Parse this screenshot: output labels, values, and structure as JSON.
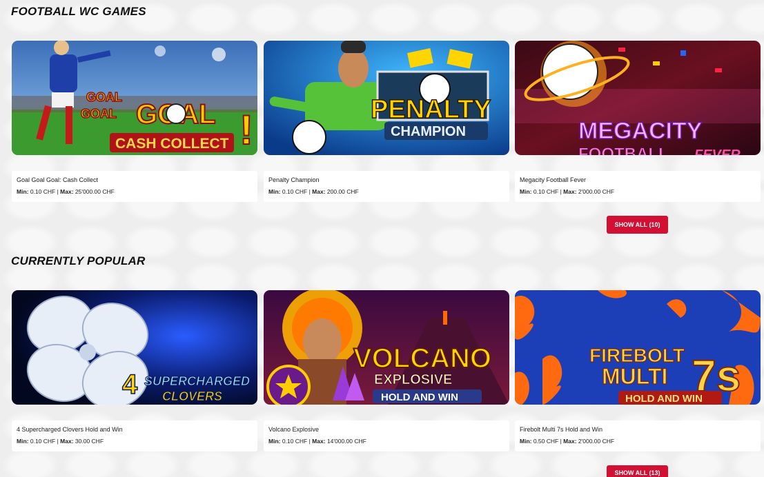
{
  "sections": [
    {
      "title": "FOOTBALL WC GAMES",
      "show_all_label": "SHOW ALL (10)",
      "games": [
        {
          "name": "Goal Goal Goal: Cash Collect",
          "min_label": "Min:",
          "min": "0.10 CHF",
          "max_label": "Max:",
          "max": "25'000.00 CHF",
          "logo": [
            "GOAL",
            "GOAL",
            "GOAL",
            "CASH COLLECT"
          ]
        },
        {
          "name": "Penalty Champion",
          "min_label": "Min:",
          "min": "0.10 CHF",
          "max_label": "Max:",
          "max": "200.00 CHF",
          "logo": [
            "PENALTY",
            "CHAMPION"
          ]
        },
        {
          "name": "Megacity Football Fever",
          "min_label": "Min:",
          "min": "0.10 CHF",
          "max_label": "Max:",
          "max": "2'000.00 CHF",
          "logo": [
            "MEGACITY",
            "FOOTBALL",
            "FEVER"
          ]
        }
      ]
    },
    {
      "title": "CURRENTLY POPULAR",
      "show_all_label": "SHOW ALL (13)",
      "games": [
        {
          "name": "4 Supercharged Clovers Hold and Win",
          "min_label": "Min:",
          "min": "0.10 CHF",
          "max_label": "Max:",
          "max": "30.00 CHF",
          "logo": [
            "4",
            "SUPERCHARGED",
            "CLOVERS"
          ]
        },
        {
          "name": "Volcano Explosive",
          "min_label": "Min:",
          "min": "0.10 CHF",
          "max_label": "Max:",
          "max": "14'000.00 CHF",
          "logo": [
            "VOLCANO",
            "EXPLOSIVE",
            "HOLD AND WIN"
          ]
        },
        {
          "name": "Firebolt Multi 7s Hold and Win",
          "min_label": "Min:",
          "min": "0.50 CHF",
          "max_label": "Max:",
          "max": "2'000.00 CHF",
          "logo": [
            "FIREBOLT",
            "MULTI",
            "7s",
            "HOLD AND WIN"
          ]
        }
      ]
    }
  ],
  "colors": {
    "accent": "#d21034",
    "page_bg": "#eeeeee",
    "card_bg": "#ffffff"
  }
}
